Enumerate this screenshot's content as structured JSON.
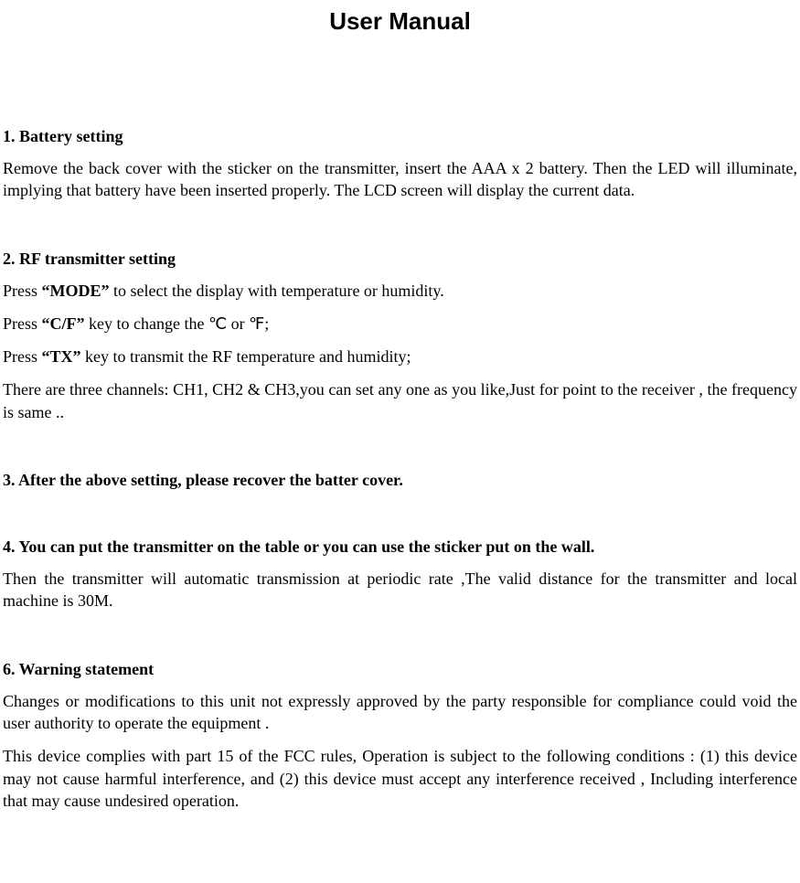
{
  "title": "User Manual",
  "s1": {
    "heading": "1. Battery setting",
    "p1": "Remove the back cover with the sticker on the transmitter, insert the AAA x 2 battery. Then the LED will illuminate, implying that battery have been inserted properly. The LCD screen will display the current data."
  },
  "s2": {
    "heading": "2. RF transmitter setting",
    "p1_a": "Press ",
    "p1_b": "“MODE”",
    "p1_c": " to select the display with temperature or humidity.",
    "p2_a": "Press ",
    "p2_b": "“C/F”",
    "p2_c": " key to change the ℃ or ℉;",
    "p3_a": "Press ",
    "p3_b": "“TX”",
    "p3_c": " key to transmit the RF temperature and humidity;",
    "p4": "There are three channels: CH1, CH2 & CH3,you can set any one as you like,Just for point to the receiver , the frequency is same .."
  },
  "s3": {
    "heading": "3. After the above setting, please recover the batter cover."
  },
  "s4": {
    "heading": "4. You can put the transmitter on the table or you can use the sticker put on the wall.",
    "p1": "Then the transmitter will automatic transmission at periodic rate ,The valid distance for the transmitter and local machine is 30M."
  },
  "s6": {
    "heading": "6. Warning statement",
    "p1": "Changes or modifications to this unit not expressly approved by the party responsible for compliance could void the user authority to operate the equipment .",
    "p2": "This device complies with part 15 of the FCC rules, Operation is subject to the following conditions : (1) this device may not cause harmful interference, and (2) this device must accept any interference received , Including interference that may cause undesired operation."
  }
}
